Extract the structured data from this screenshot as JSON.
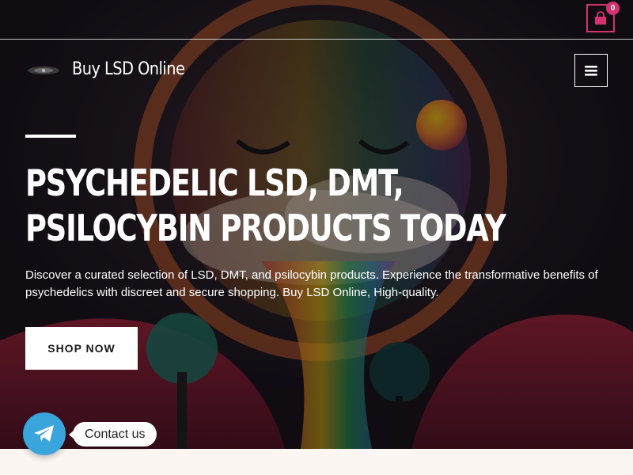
{
  "header": {
    "site_title": "Buy LSD Online",
    "cart_count": "0",
    "cart_icon": "shopping-bag-icon",
    "menu_icon": "hamburger-menu-icon"
  },
  "hero": {
    "headline": "Psychedelic LSD, DMT, Psilocybin Products Today",
    "description": "Discover a curated selection of LSD, DMT, and psilocybin products. Experience the transformative benefits of psychedelics with discreet and secure shopping. Buy LSD Online, High-quality.",
    "cta_label": "SHOP NOW"
  },
  "contact": {
    "label": "Contact us",
    "icon": "telegram-icon"
  },
  "colors": {
    "accent": "#d2336f",
    "telegram": "#3aa4dc",
    "hero_text": "#ffffff",
    "page_bg": "#fbf6f1"
  }
}
